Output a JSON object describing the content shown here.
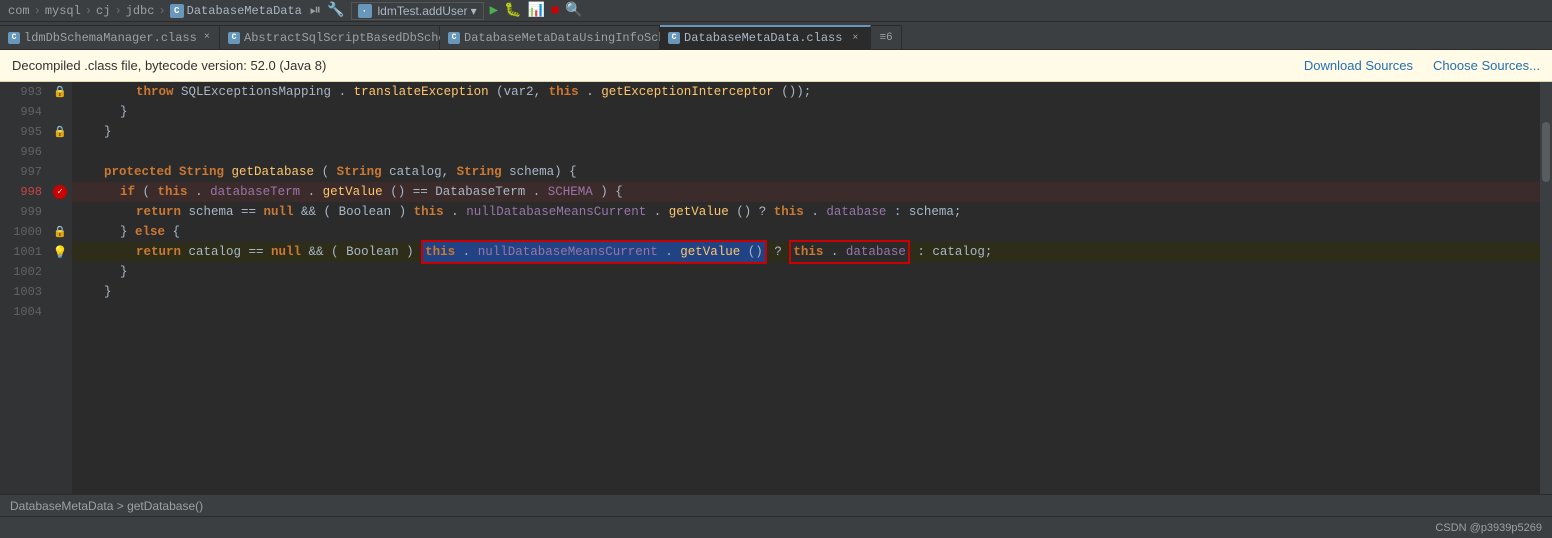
{
  "breadcrumb": {
    "items": [
      "com",
      "mysql",
      "cj",
      "jdbc",
      "DatabaseMetaData"
    ],
    "separators": [
      ">",
      ">",
      ">",
      ">"
    ]
  },
  "run_config": {
    "label": "ldmTest.addUser",
    "dropdown_arrow": "▾"
  },
  "tabs": [
    {
      "id": "tab1",
      "label": "ldmDbSchemaManager.class",
      "icon": "C",
      "active": false,
      "closeable": true
    },
    {
      "id": "tab2",
      "label": "AbstractSqlScriptBasedDbSchemaManager.java",
      "icon": "C",
      "active": false,
      "closeable": true
    },
    {
      "id": "tab3",
      "label": "DatabaseMetaDataUsingInfoSchema.class",
      "icon": "C",
      "active": false,
      "closeable": true
    },
    {
      "id": "tab4",
      "label": "DatabaseMetaData.class",
      "icon": "C",
      "active": true,
      "closeable": true
    }
  ],
  "tab_overflow_label": "≡6",
  "info_bar": {
    "text": "Decompiled .class file, bytecode version: 52.0 (Java 8)",
    "download_sources_label": "Download Sources",
    "choose_sources_label": "Choose Sources..."
  },
  "code_lines": [
    {
      "num": "993",
      "indent": 3,
      "content": "throw SQLExceptionsMapping.translateException(var2, this.getExceptionInterceptor());",
      "type": "normal",
      "lock": true
    },
    {
      "num": "994",
      "indent": 2,
      "content": "}",
      "type": "normal",
      "lock": false
    },
    {
      "num": "995",
      "indent": 1,
      "content": "}",
      "type": "normal",
      "lock": true
    },
    {
      "num": "996",
      "indent": 0,
      "content": "",
      "type": "normal",
      "lock": false
    },
    {
      "num": "997",
      "indent": 1,
      "content": "protected String getDatabase(String catalog, String schema) {",
      "type": "normal",
      "lock": false
    },
    {
      "num": "998",
      "indent": 2,
      "content": "if (this.databaseTerm.getValue() == DatabaseTerm.SCHEMA) {",
      "type": "error",
      "lock": true,
      "bp": true
    },
    {
      "num": "999",
      "indent": 3,
      "content": "return schema == null && (Boolean)this.nullDatabaseMeansCurrent.getValue() ? this.database : schema;",
      "type": "normal",
      "lock": false
    },
    {
      "num": "1000",
      "indent": 2,
      "content": "} else {",
      "type": "normal",
      "lock": true
    },
    {
      "num": "1001",
      "indent": 3,
      "content": "return catalog == null && (Boolean)this.nullDatabaseMeansCurrent.getValue() ? this.database : catalog;",
      "type": "warn",
      "lock": false,
      "bulb": true
    },
    {
      "num": "1002",
      "indent": 2,
      "content": "}",
      "type": "normal",
      "lock": false
    },
    {
      "num": "1003",
      "indent": 1,
      "content": "}",
      "type": "normal",
      "lock": false
    },
    {
      "num": "1004",
      "indent": 0,
      "content": "",
      "type": "normal",
      "lock": false
    }
  ],
  "status_bar": {
    "breadcrumb": "DatabaseMetaData  >  getDatabase()"
  },
  "bottom_bar": {
    "watermark": "CSDN @p3939p5269"
  }
}
